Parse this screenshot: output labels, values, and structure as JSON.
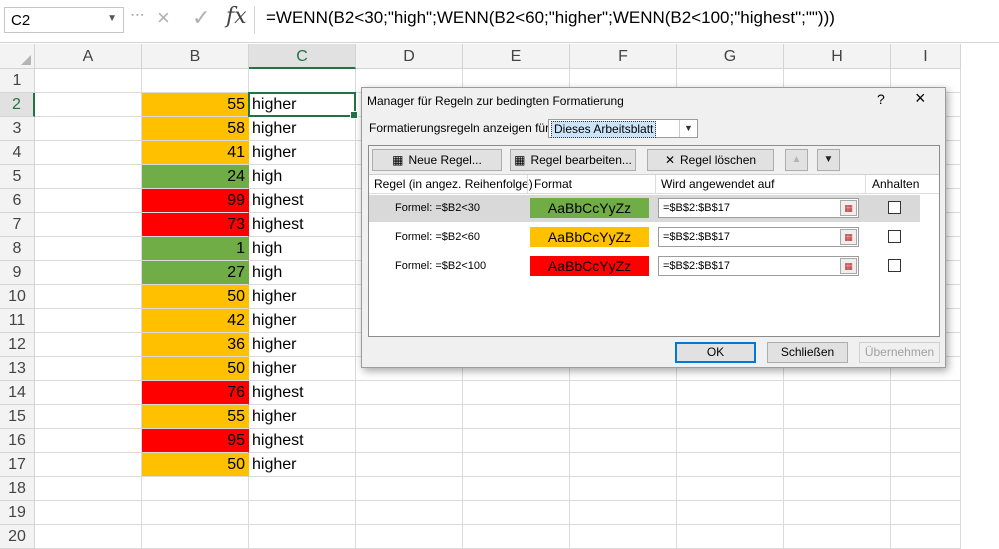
{
  "formula_bar": {
    "name_box": "C2",
    "cancel_icon": "×",
    "enter_icon": "✓",
    "fx_label": "fx",
    "formula": "=WENN(B2<30;\"high\";WENN(B2<60;\"higher\";WENN(B2<100;\"highest\";\"\")))"
  },
  "grid": {
    "columns": [
      "A",
      "B",
      "C",
      "D",
      "E",
      "F",
      "G",
      "H",
      "I"
    ],
    "rows": [
      "1",
      "2",
      "3",
      "4",
      "5",
      "6",
      "7",
      "8",
      "9",
      "10",
      "11",
      "12",
      "13",
      "14",
      "15",
      "16",
      "17",
      "18",
      "19",
      "20"
    ],
    "active_cell": "C2",
    "data": [
      {
        "row": "2",
        "value": "55",
        "label": "higher",
        "fill": "#ffc000"
      },
      {
        "row": "3",
        "value": "58",
        "label": "higher",
        "fill": "#ffc000"
      },
      {
        "row": "4",
        "value": "41",
        "label": "higher",
        "fill": "#ffc000"
      },
      {
        "row": "5",
        "value": "24",
        "label": "high",
        "fill": "#70ad47"
      },
      {
        "row": "6",
        "value": "99",
        "label": "highest",
        "fill": "#ff0000"
      },
      {
        "row": "7",
        "value": "73",
        "label": "highest",
        "fill": "#ff0000"
      },
      {
        "row": "8",
        "value": "1",
        "label": "high",
        "fill": "#70ad47"
      },
      {
        "row": "9",
        "value": "27",
        "label": "high",
        "fill": "#70ad47"
      },
      {
        "row": "10",
        "value": "50",
        "label": "higher",
        "fill": "#ffc000"
      },
      {
        "row": "11",
        "value": "42",
        "label": "higher",
        "fill": "#ffc000"
      },
      {
        "row": "12",
        "value": "36",
        "label": "higher",
        "fill": "#ffc000"
      },
      {
        "row": "13",
        "value": "50",
        "label": "higher",
        "fill": "#ffc000"
      },
      {
        "row": "14",
        "value": "76",
        "label": "highest",
        "fill": "#ff0000"
      },
      {
        "row": "15",
        "value": "55",
        "label": "higher",
        "fill": "#ffc000"
      },
      {
        "row": "16",
        "value": "95",
        "label": "highest",
        "fill": "#ff0000"
      },
      {
        "row": "17",
        "value": "50",
        "label": "higher",
        "fill": "#ffc000"
      }
    ]
  },
  "dialog": {
    "title": "Manager für Regeln zur bedingten Formatierung",
    "help": "?",
    "close": "×",
    "show_rules_label": "Formatierungsregeln anzeigen für:",
    "show_rules_value": "Dieses Arbeitsblatt",
    "toolbar": {
      "new_rule": "Neue Regel...",
      "edit_rule": "Regel bearbeiten...",
      "delete_rule": "Regel löschen",
      "move_up": "▲",
      "move_down": "▼"
    },
    "headers": {
      "rule": "Regel (in angez. Reihenfolge)",
      "format": "Format",
      "applies_to": "Wird angewendet auf",
      "stop": "Anhalten"
    },
    "rules": [
      {
        "formula": "Formel: =$B2<30",
        "sample": "AaBbCcYyZz",
        "fill": "#70ad47",
        "range": "=$B$2:$B$17",
        "stop_if_true": false,
        "selected": true
      },
      {
        "formula": "Formel: =$B2<60",
        "sample": "AaBbCcYyZz",
        "fill": "#ffc000",
        "range": "=$B$2:$B$17",
        "stop_if_true": false,
        "selected": false
      },
      {
        "formula": "Formel: =$B2<100",
        "sample": "AaBbCcYyZz",
        "fill": "#ff0000",
        "range": "=$B$2:$B$17",
        "stop_if_true": false,
        "selected": false
      }
    ],
    "buttons": {
      "ok": "OK",
      "close": "Schließen",
      "apply": "Übernehmen"
    }
  },
  "colors": {
    "excel_green": "#217346",
    "low": "#70ad47",
    "mid": "#ffc000",
    "high": "#ff0000"
  }
}
